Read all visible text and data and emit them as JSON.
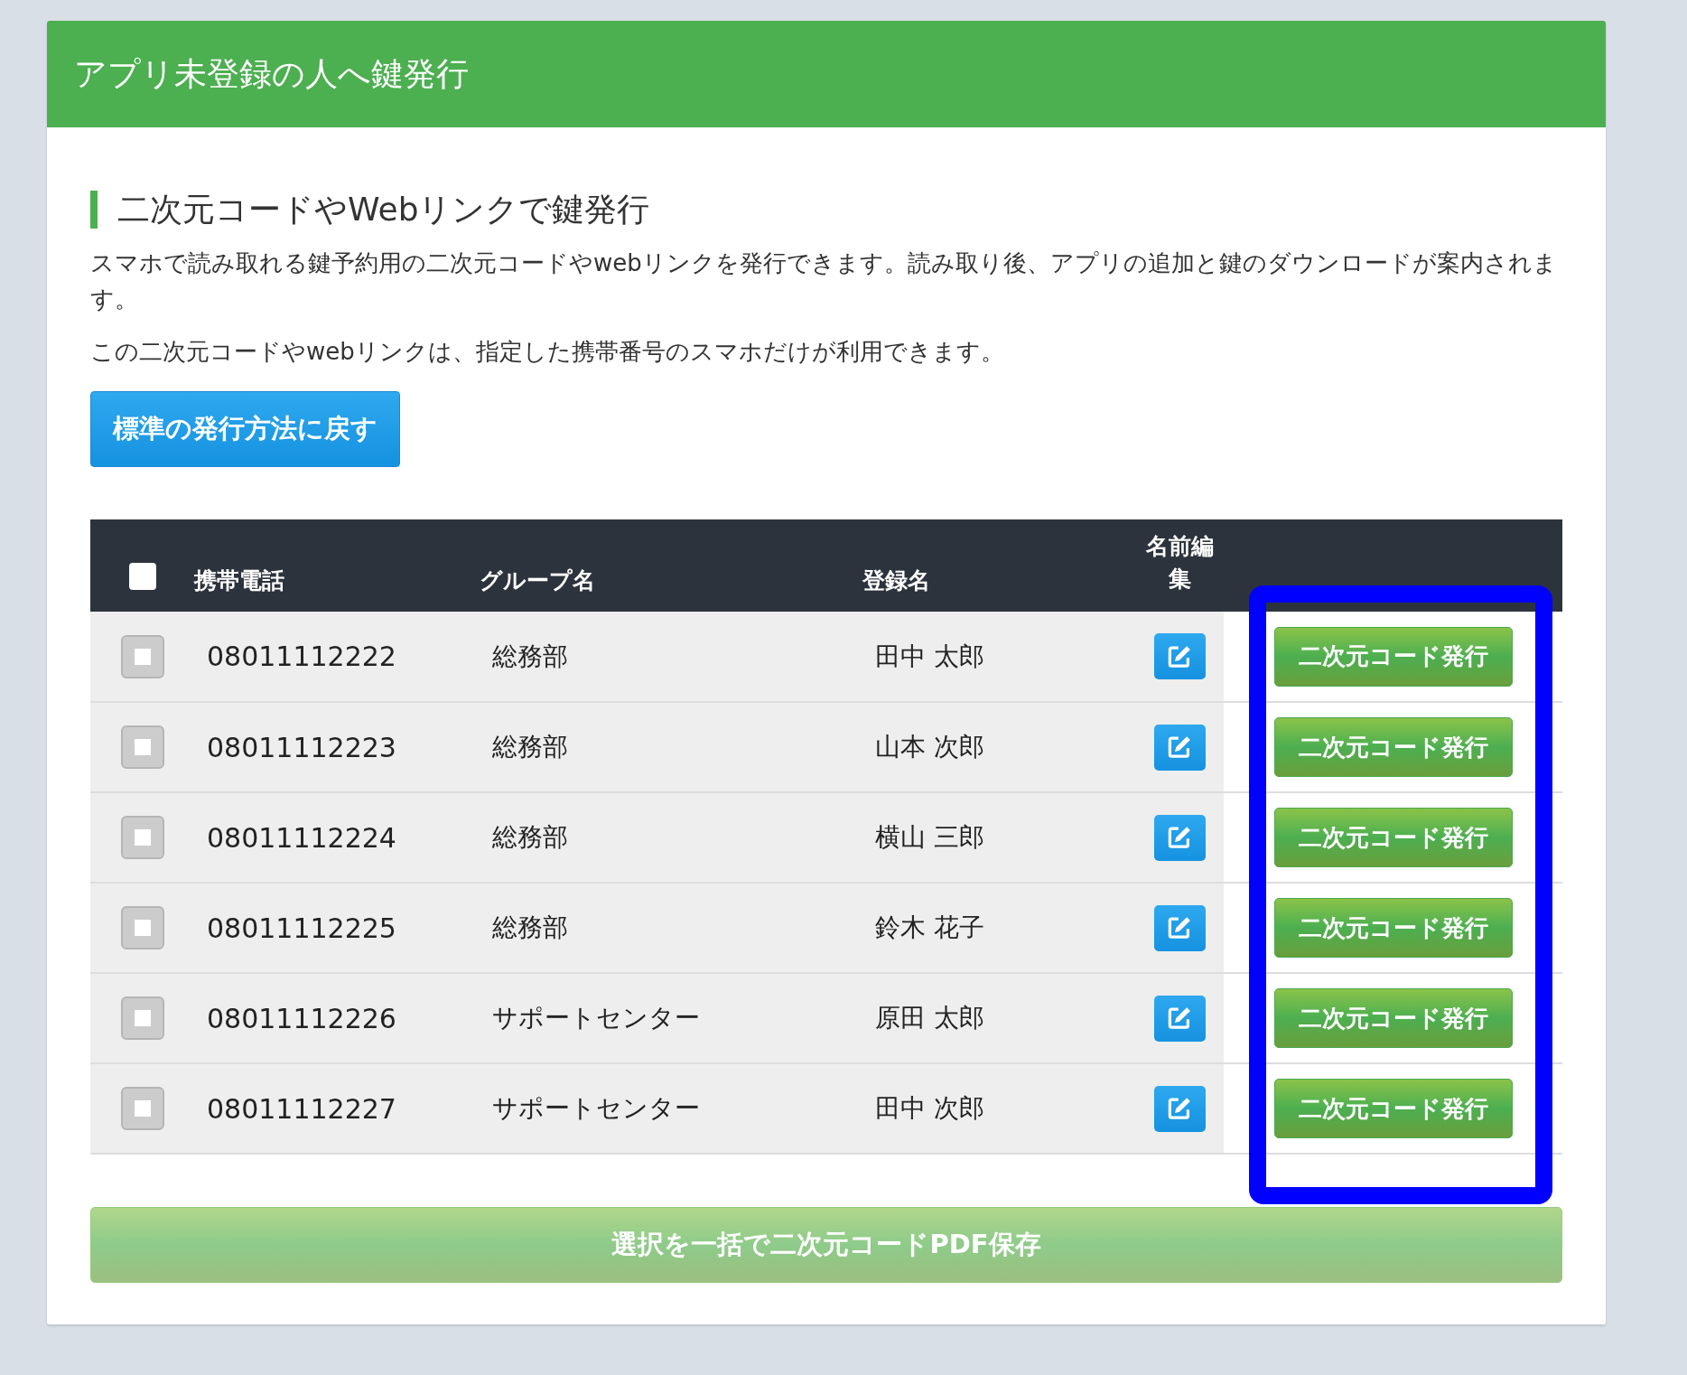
{
  "panel": {
    "title": "アプリ未登録の人へ鍵発行"
  },
  "section": {
    "heading": "二次元コードやWebリンクで鍵発行",
    "paragraphs": [
      "スマホで読み取れる鍵予約用の二次元コードやwebリンクを発行できます。読み取り後、アプリの追加と鍵のダウンロードが案内されます。",
      "この二次元コードやwebリンクは、指定した携帯番号のスマホだけが利用できます。"
    ]
  },
  "revert_button": {
    "label": "標準の発行方法に戻す"
  },
  "table": {
    "select_all": {
      "checked": false
    },
    "columns": [
      "携帯電話",
      "グループ名",
      "登録名",
      "名前編集"
    ],
    "rows": [
      {
        "checked": false,
        "phone": "08011112222",
        "group": "総務部",
        "name": "田中 太郎",
        "action": "二次元コード発行"
      },
      {
        "checked": false,
        "phone": "08011112223",
        "group": "総務部",
        "name": "山本 次郎",
        "action": "二次元コード発行"
      },
      {
        "checked": false,
        "phone": "08011112224",
        "group": "総務部",
        "name": "横山 三郎",
        "action": "二次元コード発行"
      },
      {
        "checked": false,
        "phone": "08011112225",
        "group": "総務部",
        "name": "鈴木 花子",
        "action": "二次元コード発行"
      },
      {
        "checked": false,
        "phone": "08011112226",
        "group": "サポートセンター",
        "name": "原田 太郎",
        "action": "二次元コード発行"
      },
      {
        "checked": false,
        "phone": "08011112227",
        "group": "サポートセンター",
        "name": "田中 次郎",
        "action": "二次元コード発行"
      }
    ]
  },
  "bulk_button": {
    "label": "選択を一括で二次元コードPDF保存",
    "disabled": true
  }
}
